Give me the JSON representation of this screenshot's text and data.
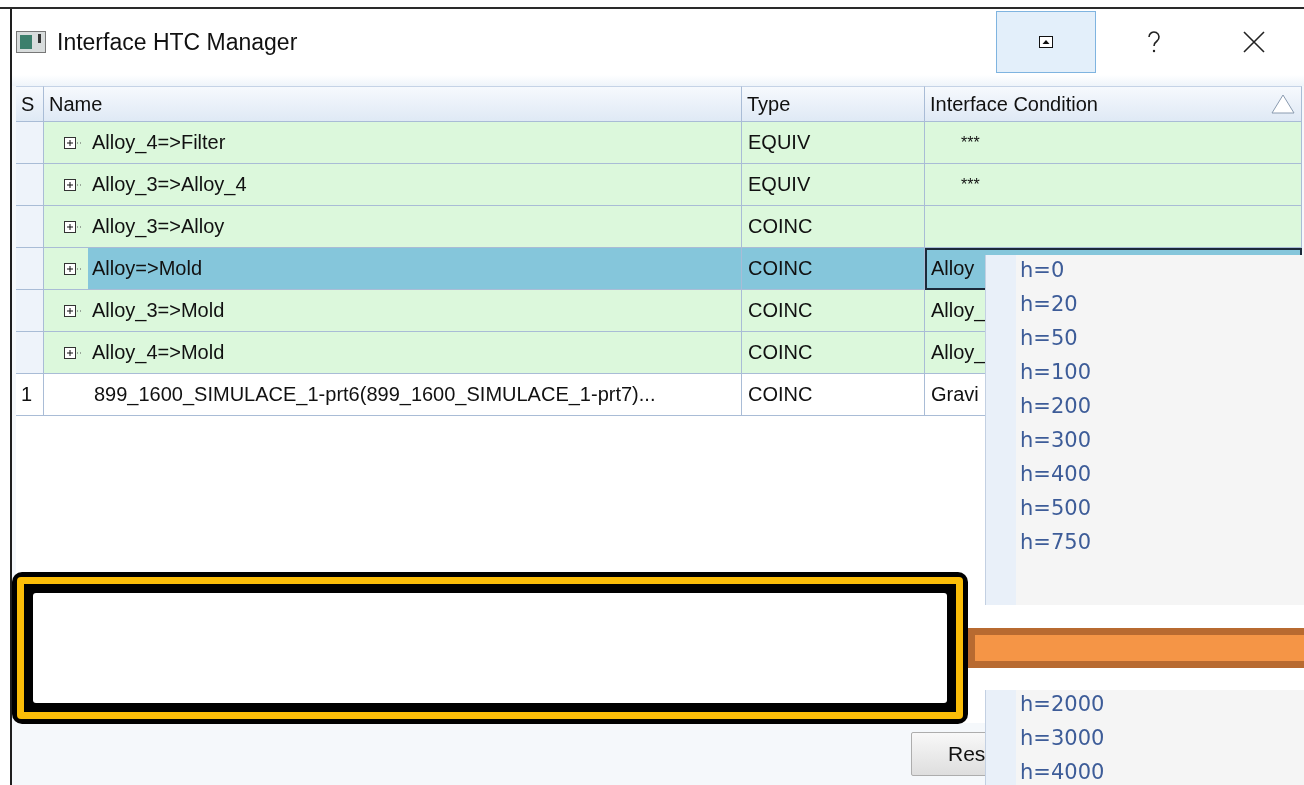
{
  "window": {
    "title": "Interface HTC Manager"
  },
  "table": {
    "columns": [
      "S",
      "Name",
      "Type",
      "Interface Condition"
    ],
    "rows": [
      {
        "s": "",
        "name": "Alloy_4=>Filter",
        "type": "EQUIV",
        "condition": "***",
        "expandable": true,
        "selected": false
      },
      {
        "s": "",
        "name": "Alloy_3=>Alloy_4",
        "type": "EQUIV",
        "condition": "***",
        "expandable": true,
        "selected": false
      },
      {
        "s": "",
        "name": "Alloy_3=>Alloy",
        "type": "COINC",
        "condition": "",
        "expandable": true,
        "selected": false
      },
      {
        "s": "",
        "name": "Alloy=>Mold",
        "type": "COINC",
        "condition": "Alloy",
        "expandable": true,
        "selected": true
      },
      {
        "s": "",
        "name": "Alloy_3=>Mold",
        "type": "COINC",
        "condition": "Alloy_",
        "expandable": true,
        "selected": false
      },
      {
        "s": "",
        "name": "Alloy_4=>Mold",
        "type": "COINC",
        "condition": "Alloy_",
        "expandable": true,
        "selected": false
      },
      {
        "s": "1",
        "name": "899_1600_SIMULACE_1-prt6(899_1600_SIMULACE_1-prt7)...",
        "type": "COINC",
        "condition": "Gravi",
        "expandable": false,
        "selected": false
      }
    ]
  },
  "dropdown": {
    "items_top": [
      "h=0",
      "h=20",
      "h=50",
      "h=100",
      "h=200",
      "h=300",
      "h=400",
      "h=500",
      "h=750"
    ],
    "items_bottom": [
      "h=2000",
      "h=3000",
      "h=4000"
    ]
  },
  "buttons": [
    "Res"
  ]
}
